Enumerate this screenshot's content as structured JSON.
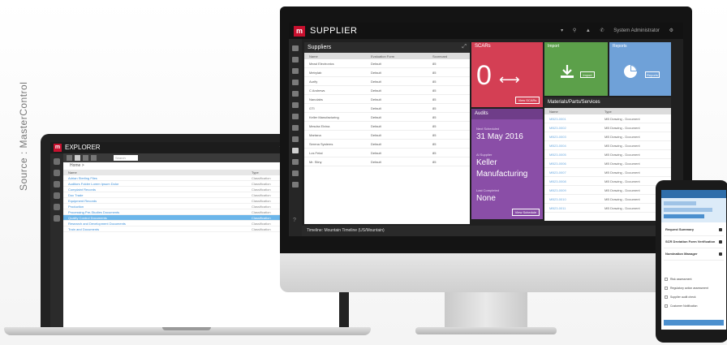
{
  "source_label": "Source : MasterControl",
  "laptop": {
    "app_title": "EXPLORER",
    "search_placeholder": "Search",
    "breadcrumb": "Home >",
    "columns": [
      "Name",
      "Type"
    ],
    "rows": [
      {
        "name": "Adrian Sterling Files",
        "type": "Classification",
        "selected": false
      },
      {
        "name": "Auditors Folder Lorem Ipsum Dolor",
        "type": "Classification",
        "selected": false
      },
      {
        "name": "Complaint Records",
        "type": "Classification",
        "selected": false
      },
      {
        "name": "Doc Trade",
        "type": "Classification",
        "selected": false
      },
      {
        "name": "Equipment Records",
        "type": "Classification",
        "selected": false
      },
      {
        "name": "Production",
        "type": "Classification",
        "selected": false
      },
      {
        "name": "Processing Pre-Studies Documents",
        "type": "Classification",
        "selected": false
      },
      {
        "name": "Quality Control Documents",
        "type": "Classification",
        "selected": true
      },
      {
        "name": "Research and Development Documents",
        "type": "Classification",
        "selected": false
      },
      {
        "name": "Train and Documents",
        "type": "Classification",
        "selected": false
      }
    ]
  },
  "monitor": {
    "app_title": "SUPPLIER",
    "header_user": "System Administrator",
    "suppliers": {
      "title": "Suppliers",
      "columns": [
        "Name",
        "Evaluation Form",
        "Scorecard"
      ],
      "rows": [
        {
          "name": "Mead Electronics",
          "eval": "Default",
          "score": "85"
        },
        {
          "name": "Metrylab",
          "eval": "Default",
          "score": "85"
        },
        {
          "name": "Aurify",
          "eval": "Default",
          "score": "85"
        },
        {
          "name": "C Andrews",
          "eval": "Default",
          "score": "85"
        },
        {
          "name": "Nanolabs",
          "eval": "Default",
          "score": "85"
        },
        {
          "name": "GTI",
          "eval": "Default",
          "score": "85"
        },
        {
          "name": "Keller Manufacturing",
          "eval": "Default",
          "score": "85"
        },
        {
          "name": "Mesdra Elvina",
          "eval": "Default",
          "score": "85"
        },
        {
          "name": "Martana",
          "eval": "Default",
          "score": "85"
        },
        {
          "name": "Serena Systems",
          "eval": "Default",
          "score": "85"
        },
        {
          "name": "Los Fetal",
          "eval": "Default",
          "score": "85"
        },
        {
          "name": "Mr. Stiny",
          "eval": "Default",
          "score": "85"
        }
      ]
    },
    "scar": {
      "title": "SCARs",
      "count": "0",
      "button": "View SCARs"
    },
    "audits": {
      "title": "Audits",
      "next_label": "Next Scheduled",
      "next_value": "31 May 2016",
      "supplier_label": "Al Supplier",
      "supplier_value": "Keller Manufacturing",
      "last_label": "Last Completed",
      "last_value": "None",
      "button": "View Schedule"
    },
    "import": {
      "title": "Import",
      "button": "Import"
    },
    "reports": {
      "title": "Reports",
      "button": "Reports"
    },
    "materials": {
      "title": "Materials/Parts/Services",
      "columns": [
        "Name",
        "Type"
      ],
      "rows": [
        {
          "name": "MB23-0001",
          "type": "MB Drawing - Document"
        },
        {
          "name": "MB23-0002",
          "type": "MB Drawing - Document"
        },
        {
          "name": "MB23-0003",
          "type": "MB Drawing - Document"
        },
        {
          "name": "MB23-0004",
          "type": "MB Drawing - Document"
        },
        {
          "name": "MB23-0005",
          "type": "MB Drawing - Document"
        },
        {
          "name": "MB23-0006",
          "type": "MB Drawing - Document"
        },
        {
          "name": "MB23-0007",
          "type": "MB Drawing - Document"
        },
        {
          "name": "MB23-0008",
          "type": "MB Drawing - Document"
        },
        {
          "name": "MB23-0009",
          "type": "MB Drawing - Document"
        },
        {
          "name": "MB23-0010",
          "type": "MB Drawing - Document"
        },
        {
          "name": "MB23-0011",
          "type": "MB Drawing - Document"
        }
      ]
    },
    "footer": "Timeline: Mountain Timeline (US/Mountain)"
  },
  "phone": {
    "items": [
      "Request Summary",
      "SCR Deviation Form Verification",
      "Nomination Manager"
    ],
    "checks": [
      "Risk assessment",
      "Regulatory action assessment",
      "Supplier audit check",
      "Customer Notification"
    ]
  }
}
